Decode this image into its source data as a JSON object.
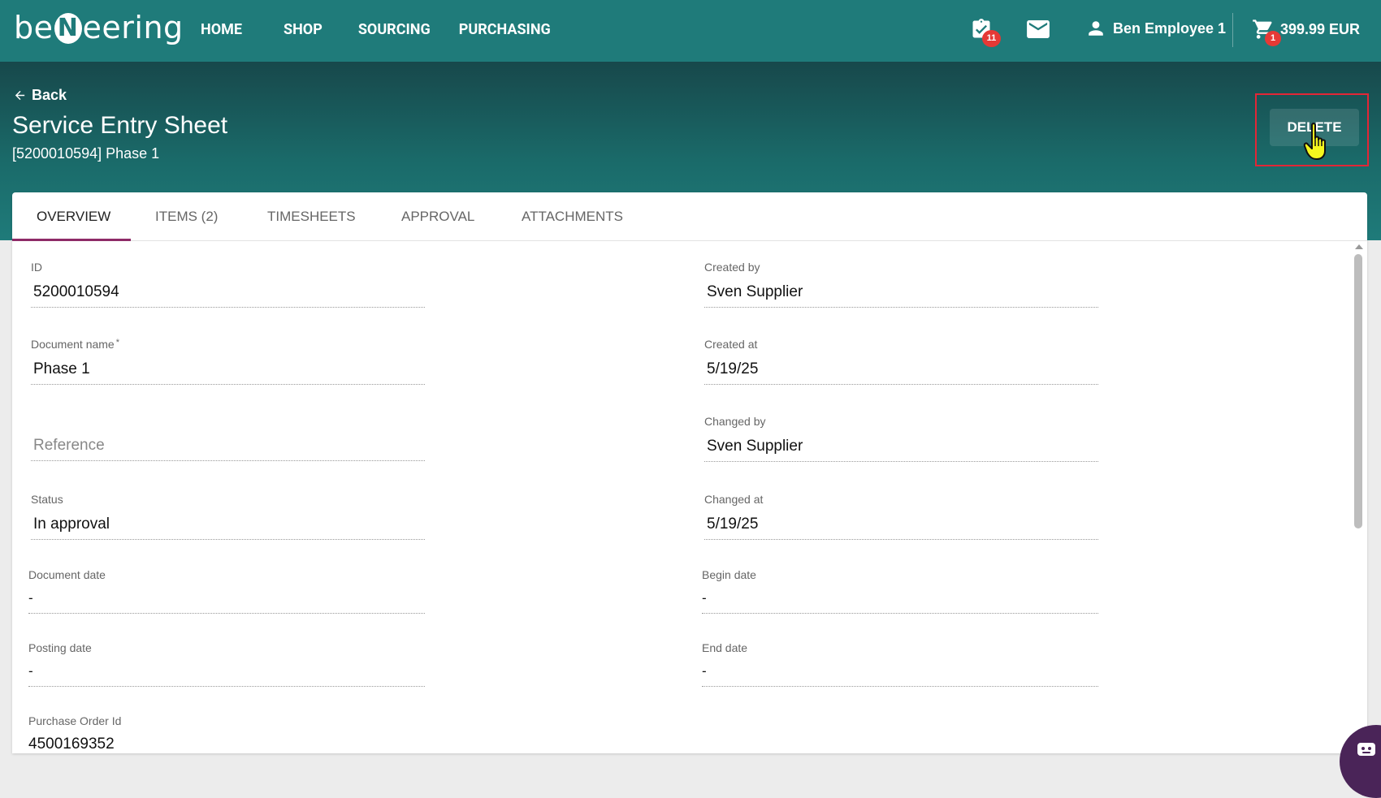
{
  "topbar": {
    "logo_pre": "be",
    "logo_mid": "N",
    "logo_post": "eering",
    "nav": [
      "HOME",
      "SHOP",
      "SOURCING",
      "PURCHASING"
    ],
    "tasks_badge": "11",
    "user_name": "Ben Employee 1",
    "cart_badge": "1",
    "cart_total": "399.99 EUR",
    "icons": [
      "clipboard-check-icon",
      "mail-icon",
      "user-icon",
      "cart-icon"
    ]
  },
  "header": {
    "back_label": "Back",
    "title": "Service Entry Sheet",
    "subtitle": "[5200010594] Phase 1",
    "delete_label": "DELETE"
  },
  "tabs": [
    "OVERVIEW",
    "ITEMS (2)",
    "TIMESHEETS",
    "APPROVAL",
    "ATTACHMENTS"
  ],
  "active_tab": "OVERVIEW",
  "fields": {
    "id": {
      "label": "ID",
      "value": "5200010594"
    },
    "document_name": {
      "label": "Document name",
      "required_mark": "*",
      "value": "Phase 1"
    },
    "reference": {
      "placeholder": "Reference"
    },
    "status": {
      "label": "Status",
      "value": "In approval"
    },
    "document_date": {
      "label": "Document date",
      "value": "-"
    },
    "posting_date": {
      "label": "Posting date",
      "value": "-"
    },
    "purchase_order_id": {
      "label": "Purchase Order Id",
      "value": "4500169352"
    },
    "created_by": {
      "label": "Created by",
      "value": "Sven Supplier"
    },
    "created_at": {
      "label": "Created at",
      "value": "5/19/25"
    },
    "changed_by": {
      "label": "Changed by",
      "value": "Sven Supplier"
    },
    "changed_at": {
      "label": "Changed at",
      "value": "5/19/25"
    },
    "begin_date": {
      "label": "Begin date",
      "value": "-"
    },
    "end_date": {
      "label": "End date",
      "value": "-"
    }
  },
  "colors": {
    "topbar": "#1f7b7a",
    "tab_underline": "#8e2b67",
    "highlight": "#e32636",
    "badge": "#e53935"
  }
}
